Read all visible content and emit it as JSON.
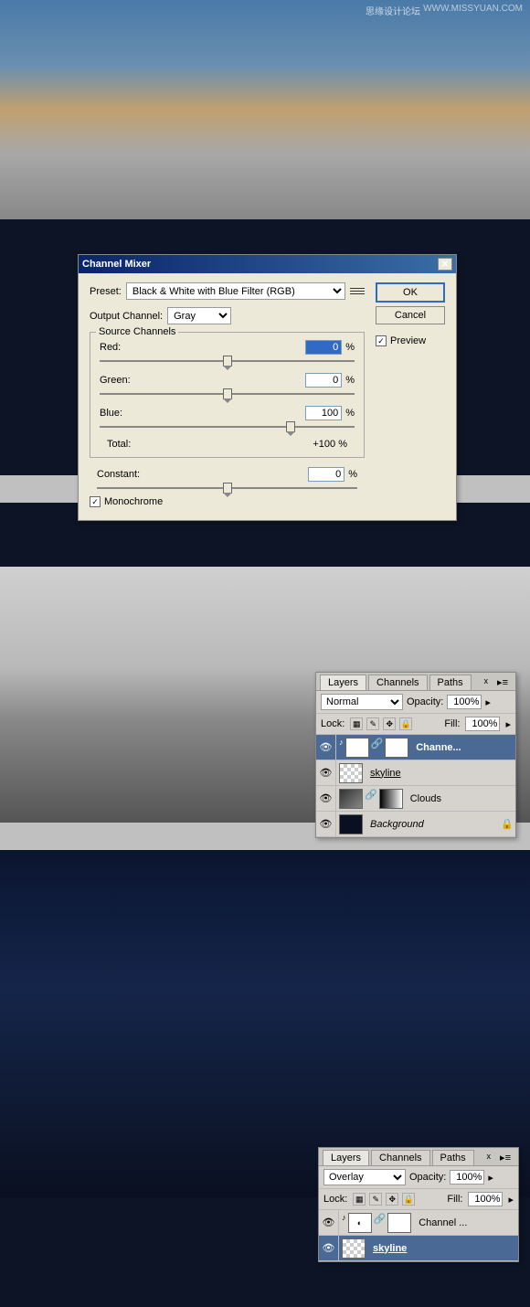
{
  "watermark": {
    "cn": "思缘设计论坛",
    "en": "WWW.MISSYUAN.COM"
  },
  "dialog": {
    "title": "Channel Mixer",
    "preset_label": "Preset:",
    "preset_value": "Black & White with Blue Filter (RGB)",
    "output_label": "Output Channel:",
    "output_value": "Gray",
    "source_legend": "Source Channels",
    "red_label": "Red:",
    "red_value": "0",
    "green_label": "Green:",
    "green_value": "0",
    "blue_label": "Blue:",
    "blue_value": "100",
    "total_label": "Total:",
    "total_value": "+100",
    "constant_label": "Constant:",
    "constant_value": "0",
    "monochrome_label": "Monochrome",
    "ok": "OK",
    "cancel": "Cancel",
    "preview": "Preview",
    "pct": "%"
  },
  "layers1": {
    "tabs": [
      "Layers",
      "Channels",
      "Paths"
    ],
    "blend": "Normal",
    "opacity_label": "Opacity:",
    "opacity_value": "100%",
    "lock_label": "Lock:",
    "fill_label": "Fill:",
    "fill_value": "100%",
    "rows": [
      {
        "name": "Channe...",
        "bold": true,
        "selected": true
      },
      {
        "name": "skyline",
        "underline": true
      },
      {
        "name": "Clouds"
      },
      {
        "name": "Background",
        "italic": true,
        "locked": true
      }
    ]
  },
  "layers2": {
    "tabs": [
      "Layers",
      "Channels",
      "Paths"
    ],
    "blend": "Overlay",
    "opacity_label": "Opacity:",
    "opacity_value": "100%",
    "lock_label": "Lock:",
    "fill_label": "Fill:",
    "fill_value": "100%",
    "rows": [
      {
        "name": "Channel ..."
      },
      {
        "name": "skyline",
        "bold": true,
        "underline": true,
        "selected": true
      }
    ]
  }
}
